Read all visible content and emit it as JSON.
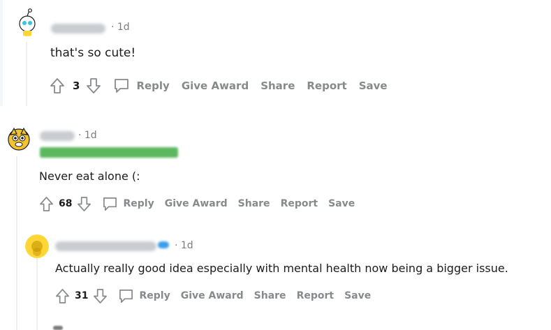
{
  "comments": [
    {
      "time": "· 1d",
      "body": "that's so cute!",
      "votes": "3",
      "actions": {
        "reply": "Reply",
        "give_award": "Give Award",
        "share": "Share",
        "report": "Report",
        "save": "Save"
      }
    },
    {
      "time": "· 1d",
      "body": "Never eat alone (:",
      "votes": "68",
      "actions": {
        "reply": "Reply",
        "give_award": "Give Award",
        "share": "Share",
        "report": "Report",
        "save": "Save"
      }
    },
    {
      "time": "· 1d",
      "body": "Actually really good idea especially with mental health now being a bigger issue.",
      "votes": "31",
      "actions": {
        "reply": "Reply",
        "give_award": "Give Award",
        "share": "Share",
        "report": "Report",
        "save": "Save"
      }
    }
  ],
  "colors": {
    "text": "#1c1c1c",
    "meta": "#878a8c",
    "time": "#7c7c7c",
    "thread_line": "#edeff1",
    "flair": "#5bb85e",
    "verified_badge": "#3c9ee8"
  },
  "icons": [
    "upvote-icon",
    "downvote-icon",
    "comment-icon",
    "snoo-avatar-icon",
    "verified-icon"
  ]
}
